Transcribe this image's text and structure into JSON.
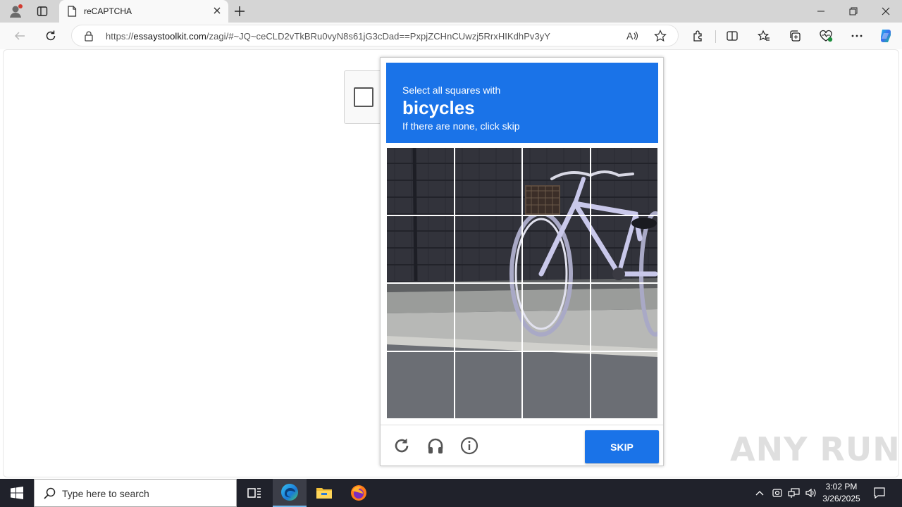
{
  "browser": {
    "tab_title": "reCAPTCHA",
    "url_prefix": "https://",
    "url_host": "essaystoolkit.com",
    "url_rest": "/zagi/#~JQ~ceCLD2vTkBRu0vyN8s61jG3cDad==PxpjZCHnCUwzj5RrxHIKdhPv3yY"
  },
  "captcha": {
    "prompt_line1": "Select all squares with",
    "prompt_object": "bicycles",
    "prompt_line3": "If there are none, click skip",
    "skip_label": "SKIP"
  },
  "watermark": "ANY RUN",
  "taskbar": {
    "search_placeholder": "Type here to search",
    "time": "3:02 PM",
    "date": "3/26/2025"
  },
  "colors": {
    "accent": "#1a73e8",
    "taskbar": "#20222b"
  }
}
